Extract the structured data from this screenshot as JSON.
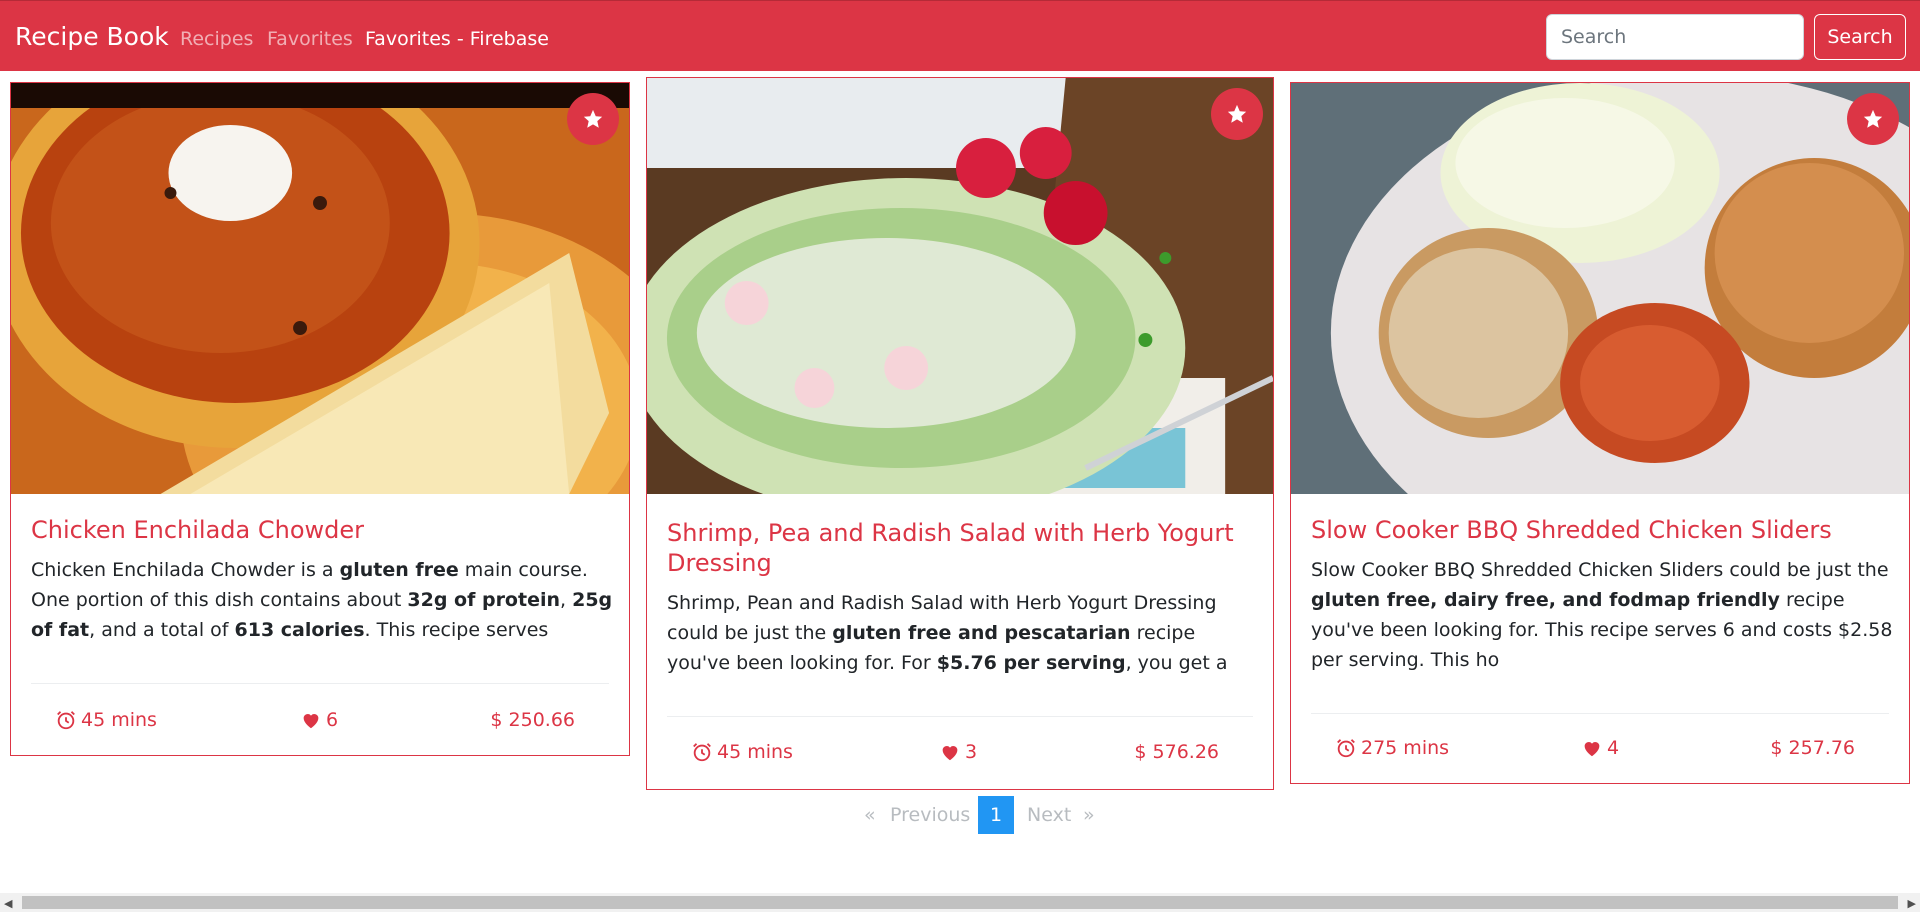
{
  "navbar": {
    "brand": "Recipe Book",
    "links": [
      {
        "label": "Recipes",
        "active": false
      },
      {
        "label": "Favorites",
        "active": false
      },
      {
        "label": "Favorites - Firebase",
        "active": true
      }
    ],
    "search": {
      "placeholder": "Search",
      "value": ""
    },
    "search_button": "Search"
  },
  "colors": {
    "accent": "#dc3545",
    "pager_active": "#2196f3"
  },
  "recipes": [
    {
      "title": "Chicken Enchilada Chowder",
      "desc": [
        {
          "t": "Chicken Enchilada Chowder is a "
        },
        {
          "t": "gluten free",
          "b": true
        },
        {
          "t": " main course. One portion of this dish contains about "
        },
        {
          "t": "32g of protein",
          "b": true
        },
        {
          "t": ", "
        },
        {
          "t": "25g of fat",
          "b": true
        },
        {
          "t": ", and a total of "
        },
        {
          "t": "613 calories",
          "b": true
        },
        {
          "t": ". This recipe serves"
        }
      ],
      "time": "45 mins",
      "likes": "6",
      "price": "$ 250.66",
      "favorite_icon": "star-icon"
    },
    {
      "title": "Shrimp, Pea and Radish Salad with Herb Yogurt Dressing",
      "desc": [
        {
          "t": "Shrimp, Pean and Radish Salad with Herb Yogurt Dressing could be just the "
        },
        {
          "t": "gluten free and pescatarian",
          "b": true
        },
        {
          "t": " recipe you've been looking for. For "
        },
        {
          "t": "$5.76 per serving",
          "b": true
        },
        {
          "t": ", you get a main course that se"
        }
      ],
      "time": "45 mins",
      "likes": "3",
      "price": "$ 576.26",
      "favorite_icon": "star-icon"
    },
    {
      "title": "Slow Cooker BBQ Shredded Chicken Sliders",
      "desc": [
        {
          "t": "Slow Cooker BBQ Shredded Chicken Sliders could be just the "
        },
        {
          "t": "gluten free, dairy free, and fodmap friendly",
          "b": true
        },
        {
          "t": " recipe you've been looking for. This recipe serves 6 and costs $2.58 per serving. This ho"
        }
      ],
      "time": "275 mins",
      "likes": "4",
      "price": "$ 257.76",
      "favorite_icon": "star-icon"
    }
  ],
  "pagination": {
    "prev_arrow": "«",
    "prev": "Previous",
    "current": "1",
    "next": "Next",
    "next_arrow": "»"
  }
}
